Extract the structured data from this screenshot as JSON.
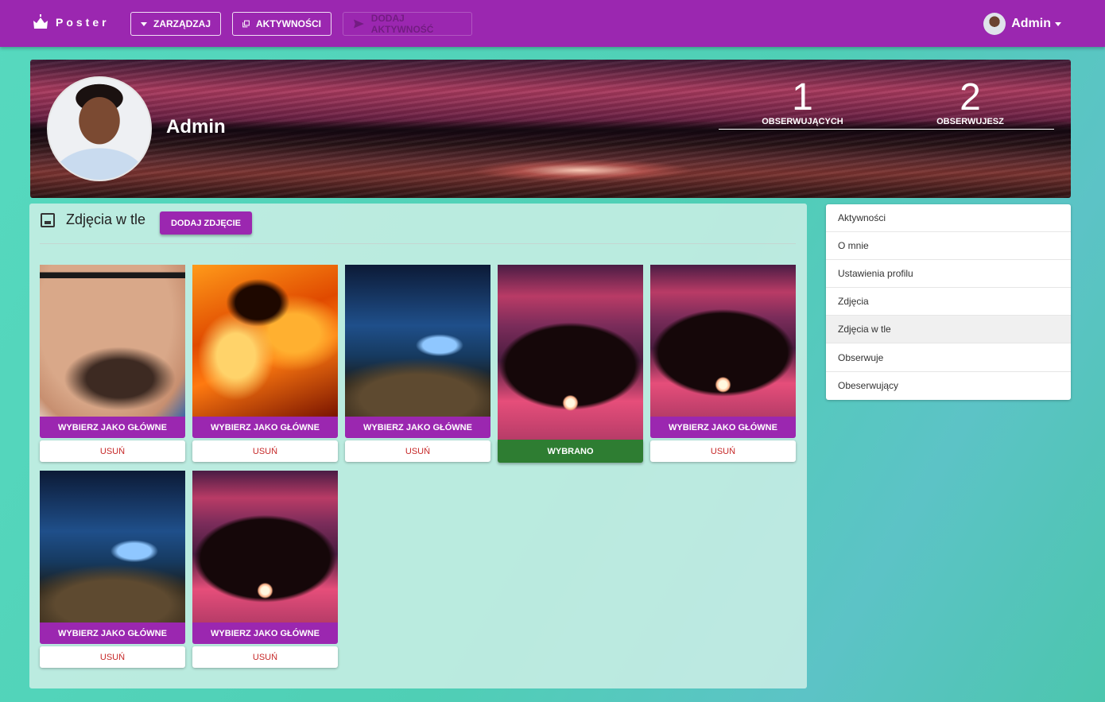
{
  "navbar": {
    "brand": "Poster",
    "manage_label": "ZARZĄDZAJ",
    "activities_label": "AKTYWNOŚCI",
    "add_activity_label": "DODAJ AKTYWNOŚĆ",
    "user_name": "Admin"
  },
  "profile": {
    "name": "Admin",
    "followers_count": "1",
    "followers_label": "OBSERWUJĄCYCH",
    "following_count": "2",
    "following_label": "OBSERWUJESZ"
  },
  "section": {
    "title": "Zdjęcia w tle",
    "add_label": "DODAJ ZDJĘCIE"
  },
  "photos": [
    {
      "kind": "face",
      "action": "WYBIERZ JAKO GŁÓWNE",
      "delete": "USUŃ"
    },
    {
      "kind": "fire",
      "action": "WYBIERZ JAKO GŁÓWNE",
      "delete": "USUŃ"
    },
    {
      "kind": "butterfly",
      "action": "WYBIERZ JAKO GŁÓWNE",
      "delete": "USUŃ"
    },
    {
      "kind": "tree",
      "action": "WYBRANO",
      "selected": true
    },
    {
      "kind": "tree",
      "action": "WYBIERZ JAKO GŁÓWNE",
      "delete": "USUŃ"
    },
    {
      "kind": "butterfly",
      "action": "WYBIERZ JAKO GŁÓWNE",
      "delete": "USUŃ"
    },
    {
      "kind": "tree",
      "action": "WYBIERZ JAKO GŁÓWNE",
      "delete": "USUŃ"
    }
  ],
  "sidebar": {
    "items": [
      {
        "label": "Aktywności"
      },
      {
        "label": "O mnie"
      },
      {
        "label": "Ustawienia profilu"
      },
      {
        "label": "Zdjęcia"
      },
      {
        "label": "Zdjęcia w tle",
        "active": true
      },
      {
        "label": "Obserwuje"
      },
      {
        "label": "Obeserwujący"
      }
    ]
  },
  "colors": {
    "primary": "#9b27b0",
    "selected": "#2e7d32",
    "delete_text": "#c62828"
  }
}
